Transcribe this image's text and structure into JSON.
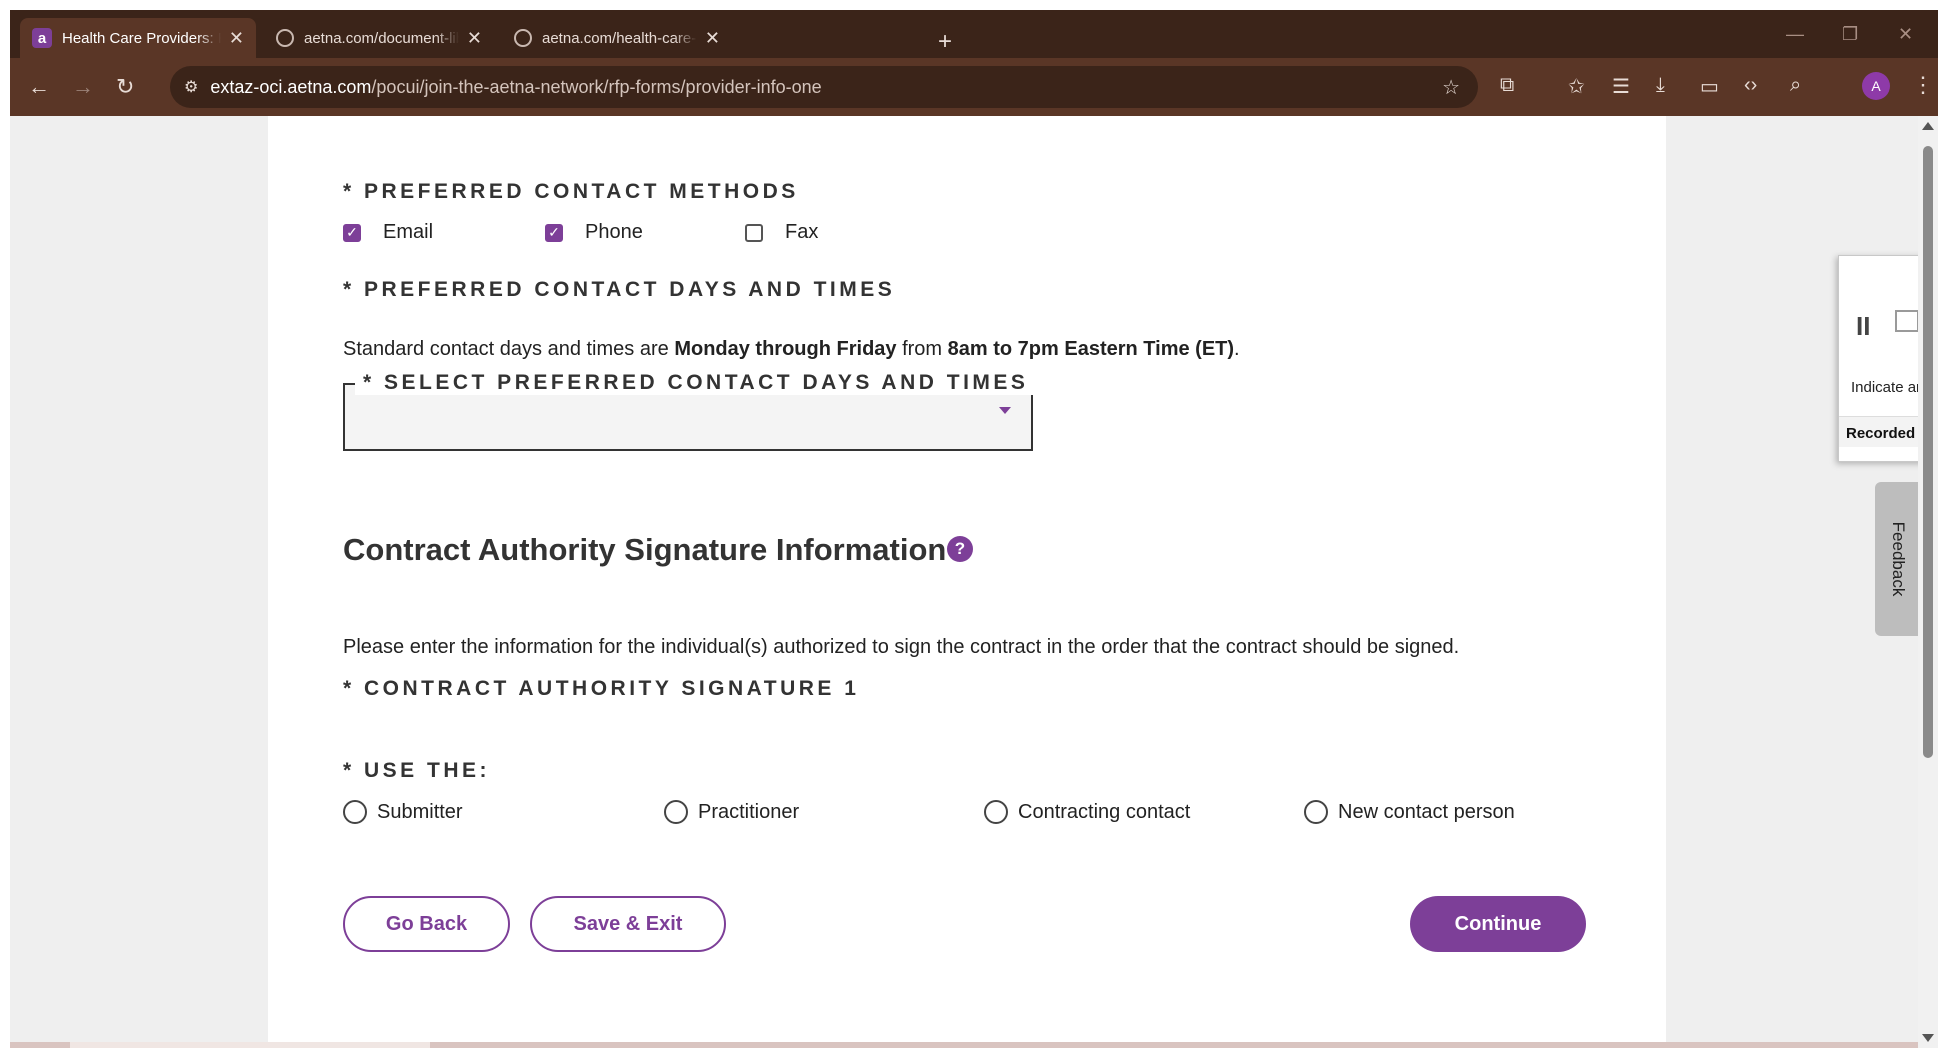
{
  "browser": {
    "tabs": [
      {
        "title": "Health Care Providers: Request",
        "active": true,
        "favicon": "aetna-logo-icon"
      },
      {
        "title": "aetna.com/document-library/he",
        "active": false,
        "favicon": "globe-icon"
      },
      {
        "title": "aetna.com/health-care-professi",
        "active": false,
        "favicon": "globe-icon"
      }
    ],
    "new_tab": "+",
    "url_host": "extaz-oci.aetna.com",
    "url_path": "/pocui/join-the-aetna-network/rfp-forms/provider-info-one",
    "profile_initial": "A"
  },
  "form": {
    "contact_methods_label": "* PREFERRED CONTACT METHODS",
    "contact_methods": [
      {
        "label": "Email",
        "checked": true
      },
      {
        "label": "Phone",
        "checked": true
      },
      {
        "label": "Fax",
        "checked": false
      }
    ],
    "contact_days_label": "* PREFERRED CONTACT DAYS AND TIMES",
    "standard_text_prefix": "Standard contact days and times are ",
    "standard_days": "Monday through Friday",
    "standard_text_mid": " from ",
    "standard_hours": "8am to 7pm Eastern Time (ET)",
    "standard_text_end": ".",
    "select_label": "* SELECT PREFERRED CONTACT DAYS AND TIMES",
    "select_value": "",
    "signature_heading": "Contract Authority Signature Information",
    "help_glyph": "?",
    "signature_instructions": "Please enter the information for the individual(s) authorized to sign the contract in the order that the contract should be signed.",
    "signature_1_label": "* CONTRACT AUTHORITY SIGNATURE 1",
    "use_the_label": "* USE THE:",
    "use_the_options": [
      "Submitter",
      "Practitioner",
      "Contracting contact",
      "New contact person"
    ]
  },
  "buttons": {
    "go_back": "Go Back",
    "save_exit": "Save & Exit",
    "continue": "Continue"
  },
  "psr": {
    "hint": "Indicate an e",
    "title": "Recorded Ste"
  },
  "feedback": "Feedback",
  "colors": {
    "brand": "#7d3f98",
    "browser_frame": "#3b2419",
    "toolbar": "#5a3626"
  }
}
